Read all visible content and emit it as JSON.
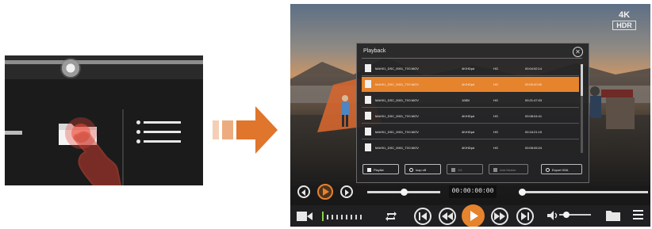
{
  "colors": {
    "accent": "#e6832d",
    "arrow": "#e0752c",
    "dialog_bg": "#242426",
    "selected_row": "#e6832d"
  },
  "player": {
    "badge_4k": "4K",
    "badge_hdr": "HDR",
    "dialog_title": "Playback",
    "files": [
      {
        "name": "MAH01_DSC_0001_TX0.MOV",
        "resolution": "4K/HDpd",
        "fps": "HG",
        "duration": "00:04:52:14",
        "selected": false
      },
      {
        "name": "MAH01_DSC_0001_TX0.MOV",
        "resolution": "4K/HDpd",
        "fps": "HG",
        "duration": "00:00:00:00",
        "selected": true
      },
      {
        "name": "MAH01_DSC_0001_TX0.MOV",
        "resolution": "1080i",
        "fps": "HG",
        "duration": "00:21:47:03",
        "selected": false
      },
      {
        "name": "MAH01_DSC_0001_TX0.MOV",
        "resolution": "4K/HDpd",
        "fps": "HG",
        "duration": "00:08:04:41",
        "selected": false
      },
      {
        "name": "MAH01_DSC_0001_TX0.MOV",
        "resolution": "4K/HDpd",
        "fps": "HG",
        "duration": "00:16:21:15",
        "selected": false
      },
      {
        "name": "MAH01_DSC_0001_TX0.MOV",
        "resolution": "4K/HDpd",
        "fps": "HG",
        "duration": "00:06:05:24",
        "selected": false
      }
    ],
    "buttons": {
      "playlist": "Playlist",
      "loop": "loop off",
      "item3": "1/6",
      "item4": "Add Marker",
      "export": "Export XML"
    },
    "timecode": "00:00:00:00",
    "progress": 0.0
  },
  "icons": {
    "closeup_folder": "folder-icon",
    "closeup_playlist": "playlist-icon",
    "closeup_hand": "hand-touch-icon",
    "camera": "camera-icon",
    "waveform": "waveform-icon",
    "repeat": "repeat-icon",
    "skip_prev": "skip-previous-icon",
    "rewind": "rewind-icon",
    "play": "play-icon",
    "fast_forward": "fast-forward-icon",
    "skip_next": "skip-next-icon",
    "volume": "volume-icon",
    "folder": "folder-icon",
    "menu": "menu-icon"
  }
}
